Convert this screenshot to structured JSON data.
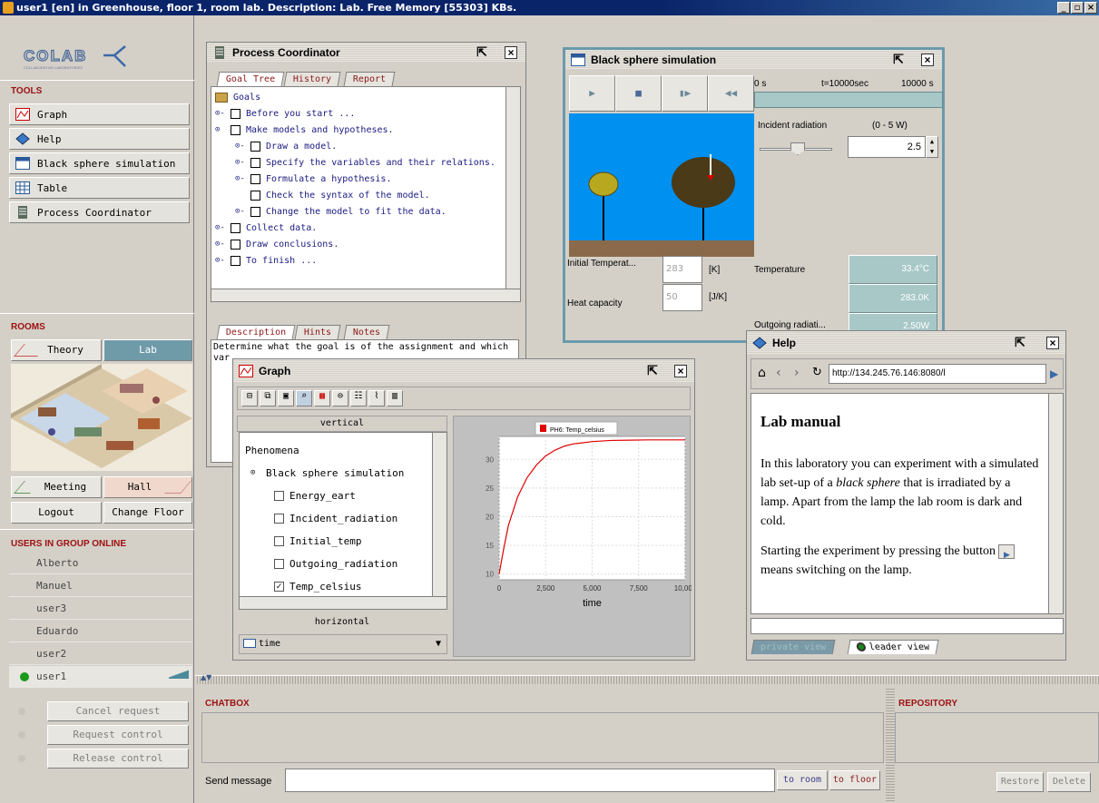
{
  "window_title": "user1 [en] in Greenhouse, floor 1, room lab. Description: Lab. Free Memory [55303] KBs.",
  "logo": {
    "text": "COLAB",
    "subtitle": "COLLABORATIVE LABORATORIES"
  },
  "tools": {
    "heading": "TOOLS",
    "items": [
      {
        "label": "Graph",
        "icon": "graph-icon"
      },
      {
        "label": "Help",
        "icon": "help-icon"
      },
      {
        "label": "Black sphere simulation",
        "icon": "simulation-icon"
      },
      {
        "label": "Table",
        "icon": "table-icon"
      },
      {
        "label": "Process Coordinator",
        "icon": "process-coordinator-icon"
      }
    ]
  },
  "rooms": {
    "heading": "ROOMS",
    "theory": "Theory",
    "lab": "Lab",
    "meeting": "Meeting",
    "hall": "Hall",
    "logout": "Logout",
    "change_floor": "Change Floor"
  },
  "users": {
    "heading": "USERS IN GROUP ONLINE",
    "list": [
      "Alberto",
      "Manuel",
      "user3",
      "Eduardo",
      "user2",
      "user1"
    ]
  },
  "control": {
    "cancel": "Cancel request",
    "request": "Request control",
    "release": "Release control"
  },
  "process_coordinator": {
    "title": "Process Coordinator",
    "tabs": [
      "Goal Tree",
      "History",
      "Report"
    ],
    "root": "Goals",
    "goals": [
      "Before you start ...",
      "Make models and hypotheses.",
      "Draw a model.",
      "Specify the variables and their relations.",
      "Formulate a hypothesis.",
      "Check the syntax of the model.",
      "Change the model to fit the data.",
      "Collect data.",
      "Draw conclusions.",
      "To finish ..."
    ],
    "bottom_tabs": [
      "Description",
      "Hints",
      "Notes"
    ],
    "description": "Determine what the goal is of the assignment and which var"
  },
  "simulation": {
    "title": "Black sphere simulation",
    "time_start": "0 s",
    "time_mid": "t=10000sec",
    "time_end": "10000 s",
    "incident_label": "Incident radiation",
    "incident_range": "(0 - 5 W)",
    "incident_value": "2.5",
    "initial_temp_label": "Initial Temperat...",
    "initial_temp_value": "283",
    "initial_temp_unit": "[K]",
    "heat_cap_label": "Heat capacity",
    "heat_cap_value": "50",
    "heat_cap_unit": "[J/K]",
    "temperature_label": "Temperature",
    "temperature_c": "33.4°C",
    "temperature_k": "283.0K",
    "outgoing_label": "Outgoing radiati...",
    "outgoing_value": "2.50W"
  },
  "graph": {
    "title": "Graph",
    "vertical": "vertical",
    "horizontal": "horizontal",
    "phenomena": "Phenomena",
    "sim_node": "Black sphere simulation",
    "variables": [
      {
        "name": "Energy_eart",
        "checked": false
      },
      {
        "name": "Incident_radiation",
        "checked": false
      },
      {
        "name": "Initial_temp",
        "checked": false
      },
      {
        "name": "Outgoing_radiation",
        "checked": false
      },
      {
        "name": "Temp_celsius",
        "checked": true
      }
    ],
    "x_var": "time",
    "legend": "PH6: Temp_celsius",
    "xlabel": "time"
  },
  "chart_data": {
    "type": "line",
    "title": "",
    "xlabel": "time",
    "ylabel": "",
    "xlim": [
      0,
      10000
    ],
    "ylim": [
      9,
      34
    ],
    "x_ticks": [
      "0",
      "2,500",
      "5,000",
      "7,500",
      "10,000"
    ],
    "y_ticks": [
      "10",
      "15",
      "20",
      "25",
      "30"
    ],
    "series": [
      {
        "name": "PH6: Temp_celsius",
        "color": "#e00000",
        "x": [
          0,
          250,
          500,
          1000,
          1500,
          2000,
          2500,
          3000,
          3500,
          4000,
          5000,
          6000,
          7000,
          8000,
          9000,
          10000
        ],
        "y": [
          10,
          14.5,
          18.5,
          23.5,
          26.8,
          29.0,
          30.6,
          31.6,
          32.3,
          32.7,
          33.1,
          33.3,
          33.35,
          33.4,
          33.4,
          33.4
        ]
      }
    ],
    "grid": true,
    "legend": "top"
  },
  "help": {
    "title": "Help",
    "url": "http://134.245.76.146:8080/l",
    "heading": "Lab manual",
    "para1_a": "In this laboratory you can experiment with a simulated lab set-up of a ",
    "para1_em": "black sphere",
    "para1_b": " that is irradiated by a lamp. Apart from the lamp the lab room is dark and cold.",
    "para2_a": "Starting the experiment by pressing the button",
    "para2_b": "means switching on the lamp.",
    "private_tab": "private view",
    "leader_tab": "leader view"
  },
  "chat": {
    "heading": "CHATBOX",
    "send_label": "Send message",
    "to_room": "to room",
    "to_floor": "to floor"
  },
  "repository": {
    "heading": "REPOSITORY",
    "restore": "Restore",
    "delete": "Delete"
  }
}
